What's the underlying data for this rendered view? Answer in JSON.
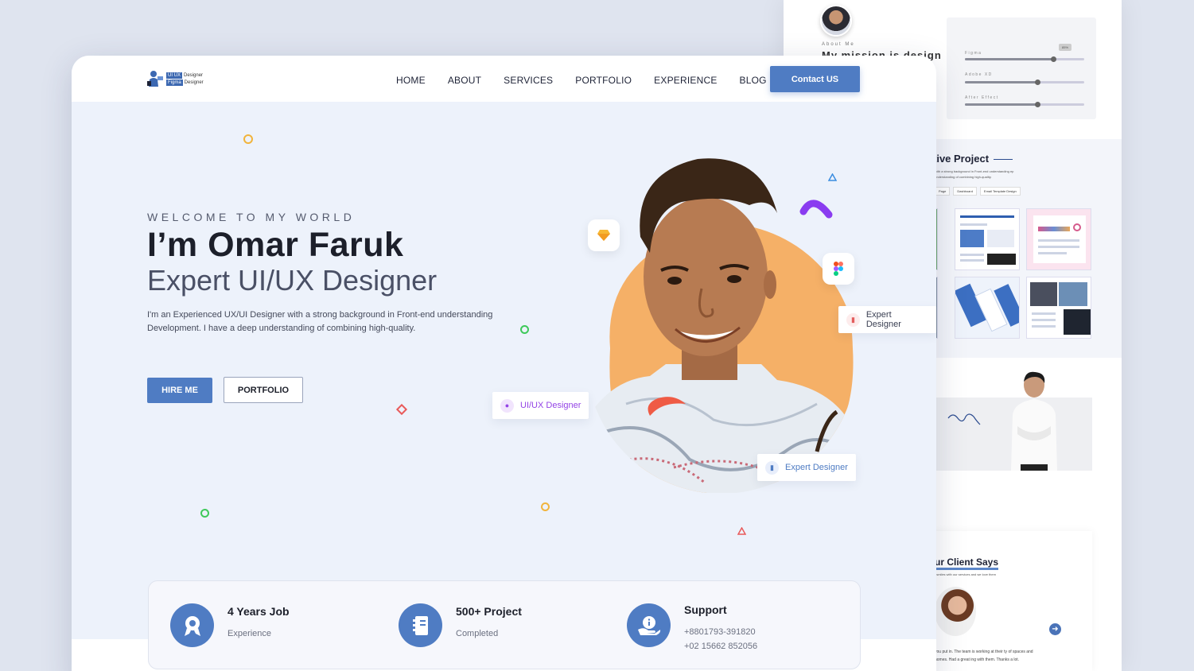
{
  "nav": {
    "logo_tag1": "UI UX",
    "logo_text1": "Designer",
    "logo_tag2": "Figma",
    "logo_text2": "Designer",
    "items": [
      "HOME",
      "ABOUT",
      "SERVICES",
      "PORTFOLIO",
      "EXPERIENCE",
      "BLOG"
    ],
    "contact_label": "Contact US"
  },
  "hero": {
    "welcome": "WELCOME TO MY WORLD",
    "name": "I’m Omar Faruk",
    "role": "Expert UI/UX Designer",
    "description": "I'm an Experienced UX/UI Designer with a strong background in Front-end understanding Development. I have a deep understanding of combining high-quality.",
    "hire_label": "HIRE ME",
    "portfolio_label": "PORTFOLIO"
  },
  "badges": {
    "expert1": "Expert Designer",
    "uiux": "UI/UX Designer",
    "expert2": "Expert Designer"
  },
  "stats": [
    {
      "title": "4 Years Job",
      "sub": "Experience",
      "icon": "award-icon"
    },
    {
      "title": "500+ Project",
      "sub": "Completed",
      "icon": "notebook-icon"
    },
    {
      "title": "Support",
      "sub": "+8801793-391820",
      "sub2": "+02 15662 852056",
      "icon": "hand-info-icon"
    }
  ],
  "back_page": {
    "about_small": "About Me",
    "mission": "My mission is design",
    "skills": [
      {
        "name": "Figma",
        "level": 0.85
      },
      {
        "name": "Adobe XD",
        "level": 0.7
      },
      {
        "name": "After Effect",
        "level": 0.7
      }
    ],
    "skill_badge": "85%",
    "project_title": "tive Project",
    "project_desc": "with a strong background in Front-end understanding ep understanding of combining high-quality.",
    "project_tabs": [
      "Page",
      "Dashboard",
      "Email Template Design"
    ],
    "client_title": "ur Client Says",
    "client_sub": "f smiles with our services and we love them",
    "testimonial": "you put in. The team is working at their ty of spaces and homes. Had a great ing with them. Thanks a lot."
  },
  "colors": {
    "accent": "#4f7cc3",
    "hero_bg": "#edf2fb",
    "orange_blob": "#f5b067"
  }
}
